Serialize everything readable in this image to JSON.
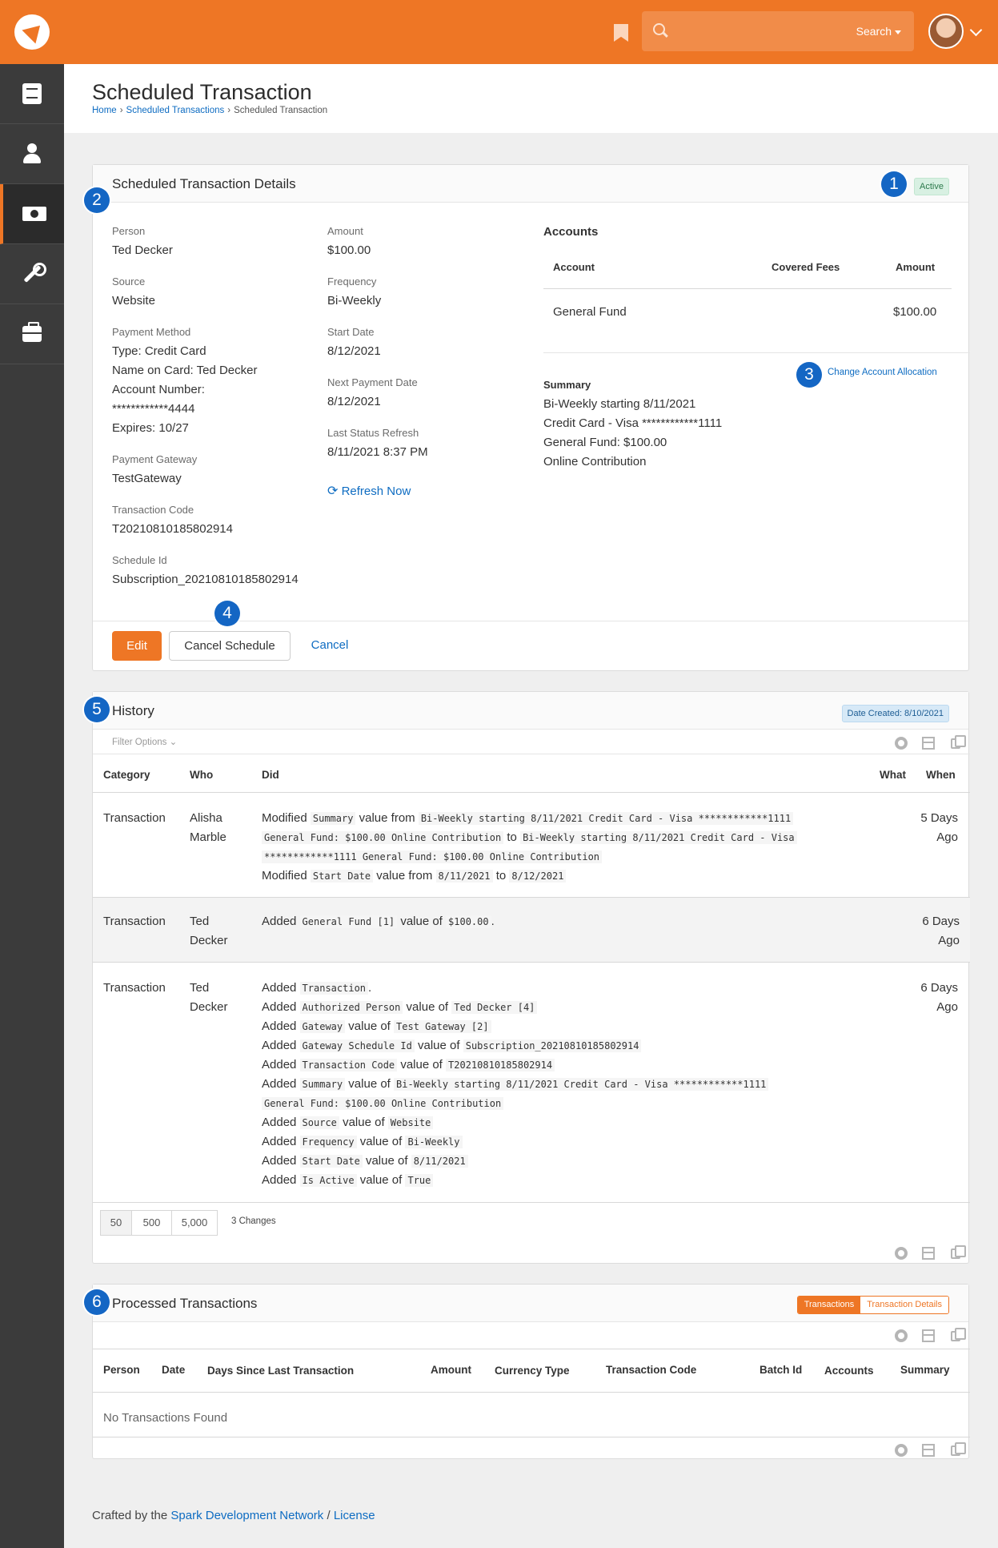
{
  "header": {
    "search_label": "Search"
  },
  "page": {
    "title": "Scheduled Transaction",
    "breadcrumb": [
      "Home",
      "Scheduled Transactions",
      "Scheduled Transaction"
    ]
  },
  "details": {
    "title": "Scheduled Transaction Details",
    "status": "Active",
    "person_label": "Person",
    "person": "Ted Decker",
    "source_label": "Source",
    "source": "Website",
    "payment_method_label": "Payment Method",
    "payment_method_lines": [
      "Type: Credit Card",
      "Name on Card: Ted Decker",
      "Account Number:",
      "************4444",
      "Expires: 10/27"
    ],
    "gateway_label": "Payment Gateway",
    "gateway": "TestGateway",
    "txn_code_label": "Transaction Code",
    "txn_code": "T20210810185802914",
    "schedule_id_label": "Schedule Id",
    "schedule_id": "Subscription_20210810185802914",
    "amount_label": "Amount",
    "amount": "$100.00",
    "frequency_label": "Frequency",
    "frequency": "Bi-Weekly",
    "start_date_label": "Start Date",
    "start_date": "8/12/2021",
    "next_payment_label": "Next Payment Date",
    "next_payment": "8/12/2021",
    "last_refresh_label": "Last Status Refresh",
    "last_refresh": "8/11/2021 8:37 PM",
    "refresh_now": "Refresh Now",
    "accounts_title": "Accounts",
    "accounts_headers": [
      "Account",
      "Covered Fees",
      "Amount"
    ],
    "accounts_rows": [
      {
        "account": "General Fund",
        "fees": "",
        "amount": "$100.00"
      }
    ],
    "change_allocation": "Change Account Allocation",
    "summary_label": "Summary",
    "summary_lines": [
      "Bi-Weekly starting 8/11/2021",
      "Credit Card - Visa ************1111",
      "General Fund: $100.00",
      "Online Contribution"
    ],
    "btn_edit": "Edit",
    "btn_cancel_schedule": "Cancel Schedule",
    "btn_cancel": "Cancel"
  },
  "history": {
    "title": "History",
    "date_created": "Date Created: 8/10/2021",
    "filter_options": "Filter Options",
    "headers": [
      "Category",
      "Who",
      "Did",
      "What",
      "When"
    ],
    "rows": [
      {
        "category": "Transaction",
        "who": [
          "Alisha",
          "Marble"
        ],
        "when": [
          "5 Days",
          "Ago"
        ]
      },
      {
        "category": "Transaction",
        "who": [
          "Ted",
          "Decker"
        ],
        "when": [
          "6 Days",
          "Ago"
        ]
      },
      {
        "category": "Transaction",
        "who": [
          "Ted",
          "Decker"
        ],
        "when": [
          "6 Days",
          "Ago"
        ]
      }
    ],
    "r1": {
      "w1": "Modified",
      "c1": "Summary",
      "w2": "value from",
      "c2": "Bi-Weekly starting 8/11/2021 Credit Card - Visa ************1111",
      "c3": "General Fund: $100.00 Online Contribution",
      "w3": "to",
      "c4": "Bi-Weekly starting 8/11/2021 Credit Card - Visa",
      "c5": "************1111 General Fund: $100.00 Online Contribution",
      "w4": "Modified",
      "c6": "Start Date",
      "w5": "value from",
      "c7": "8/11/2021",
      "w6": "to",
      "c8": "8/12/2021"
    },
    "r2": {
      "w1": "Added",
      "c1": "General Fund [1]",
      "w2": "value of",
      "c2": "$100.00",
      "w3": "."
    },
    "r3": {
      "added": "Added",
      "valueof": "value of",
      "l1": "Transaction",
      "l1dot": ".",
      "l2a": "Authorized Person",
      "l2b": "Ted Decker [4]",
      "l3a": "Gateway",
      "l3b": "Test Gateway [2]",
      "l4a": "Gateway Schedule Id",
      "l4b": "Subscription_20210810185802914",
      "l5a": "Transaction Code",
      "l5b": "T20210810185802914",
      "l6a": "Summary",
      "l6b": "Bi-Weekly starting 8/11/2021 Credit Card - Visa ************1111",
      "l6c": "General Fund: $100.00 Online Contribution",
      "l7a": "Source",
      "l7b": "Website",
      "l8a": "Frequency",
      "l8b": "Bi-Weekly",
      "l9a": "Start Date",
      "l9b": "8/11/2021",
      "l10a": "Is Active",
      "l10b": "True"
    },
    "pager": [
      "50",
      "500",
      "5,000"
    ],
    "changes": "3 Changes"
  },
  "processed": {
    "title": "Processed Transactions",
    "toggle": [
      "Transactions",
      "Transaction Details"
    ],
    "headers": [
      "Person",
      "Date",
      "Days Since Last Transaction",
      "Amount",
      "Currency Type",
      "Transaction Code",
      "Batch Id",
      "Accounts",
      "Summary"
    ],
    "empty": "No Transactions Found"
  },
  "callouts": [
    "1",
    "2",
    "3",
    "4",
    "5",
    "6"
  ],
  "footer": {
    "prefix": "Crafted by the",
    "link1": "Spark Development Network",
    "sep": "/",
    "link2": "License"
  },
  "colors": {
    "brand": "#ee7625",
    "link": "#0e6cc2",
    "callout": "#1466c4",
    "sidebar": "#3b3b3b"
  }
}
